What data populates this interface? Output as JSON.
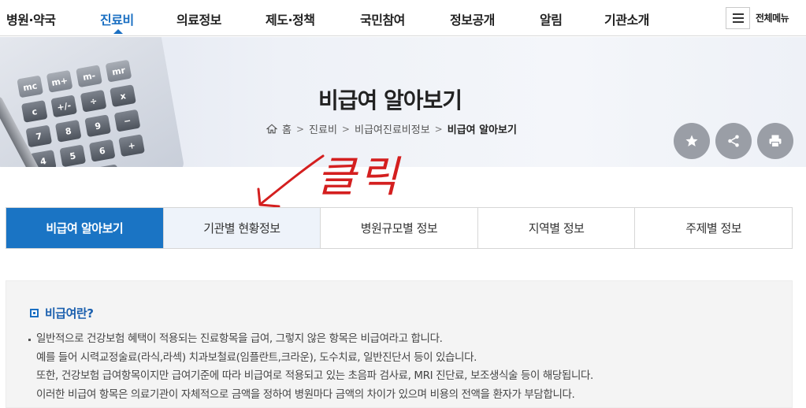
{
  "nav": {
    "items": [
      {
        "label": "병원·약국",
        "active": false
      },
      {
        "label": "진료비",
        "active": true
      },
      {
        "label": "의료정보",
        "active": false
      },
      {
        "label": "제도·정책",
        "active": false
      },
      {
        "label": "국민참여",
        "active": false
      },
      {
        "label": "정보공개",
        "active": false
      },
      {
        "label": "알림",
        "active": false
      },
      {
        "label": "기관소개",
        "active": false
      }
    ],
    "menu_label": "전체메뉴",
    "accent": "#1a6fc2"
  },
  "banner": {
    "title": "비급여 알아보기",
    "breadcrumb": [
      "홈",
      "진료비",
      "비급여진료비정보",
      "비급여 알아보기"
    ],
    "calculator_keys": [
      "mc",
      "m+",
      "m-",
      "mr",
      "c",
      "+/-",
      "÷",
      "x",
      "7",
      "8",
      "9",
      "−",
      "4",
      "5",
      "6",
      "+",
      "1",
      "2",
      "3"
    ],
    "action_icons": [
      "star-icon",
      "share-icon",
      "print-icon"
    ]
  },
  "annotation": {
    "text": "클릭",
    "color": "#d41f1f"
  },
  "tabs": [
    {
      "label": "비급여 알아보기",
      "active": true
    },
    {
      "label": "기관별 현황정보",
      "active": false
    },
    {
      "label": "병원규모별 정보",
      "active": false
    },
    {
      "label": "지역별 정보",
      "active": false
    },
    {
      "label": "주제별 정보",
      "active": false
    }
  ],
  "info": {
    "title": "비급여란?",
    "lines": [
      "일반적으로 건강보험 혜택이 적용되는 진료항목을 급여, 그렇지 않은 항목은 비급여라고 합니다.",
      "예를 들어 시력교정술료(라식,라섹) 치과보철료(임플란트,크라운), 도수치료, 일반진단서 등이 있습니다.",
      "또한, 건강보험 급여항목이지만 급여기준에 따라 비급여로 적용되고 있는 초음파 검사료, MRI 진단료, 보조생식술 등이 해당됩니다.",
      "이러한 비급여 항목은 의료기관이 자체적으로 금액을 정하여 병원마다 금액의 차이가 있으며 비용의 전액을 환자가 부담합니다."
    ]
  }
}
